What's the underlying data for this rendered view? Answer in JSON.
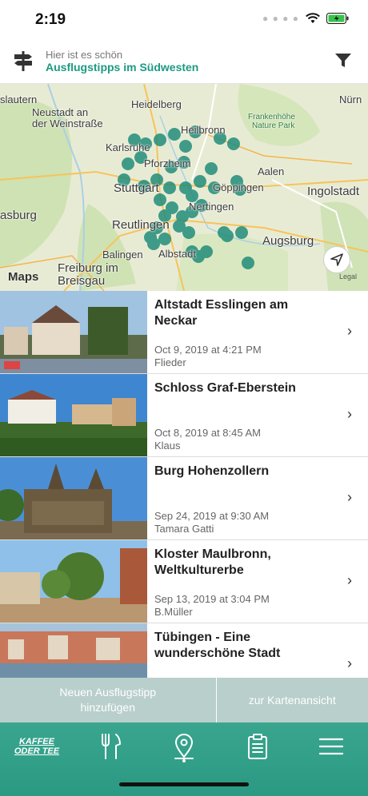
{
  "status_bar": {
    "time": "2:19"
  },
  "header": {
    "subtitle": "Hier ist es schön",
    "title": "Ausflugstipps im Südwesten",
    "icons": [
      "signpost-icon",
      "filter-icon"
    ]
  },
  "map": {
    "labels": [
      "Nürn",
      "Heidelberg",
      "Heilbronn",
      "Frankenhöhe",
      "Nature Park",
      "Karlsruhe",
      "Pforzheim",
      "Aalen",
      "Stuttgart",
      "Göppingen",
      "Ingolstadt",
      "asburg",
      "Reutlingen",
      "Nertingen",
      "Augsburg",
      "Balingen",
      "Albstadt",
      "Freiburg im",
      "Breisgau",
      "Legal",
      "slautern",
      "Neustadt an",
      "der Weinstraße",
      "Maps"
    ],
    "accent": "#1a8a78"
  },
  "list": {
    "items": [
      {
        "title": "Altstadt Esslingen am Neckar",
        "date": "Oct 9, 2019 at 4:21 PM",
        "author": "Flieder"
      },
      {
        "title": "Schloss Graf-Eberstein",
        "date": "Oct 8, 2019 at 8:45 AM",
        "author": "Klaus"
      },
      {
        "title": "Burg Hohenzollern",
        "date": "Sep 24, 2019 at 9:30 AM",
        "author": "Tamara Gatti"
      },
      {
        "title": "Kloster Maulbronn, Weltkulturerbe",
        "date": "Sep 13, 2019 at 3:04 PM",
        "author": "B.Müller"
      },
      {
        "title": "Tübingen - Eine wunderschöne Stadt",
        "date": "",
        "author": ""
      }
    ],
    "chevron": "›"
  },
  "actions": {
    "add_tip": "Neuen Ausflugstipp hinzufügen",
    "map_view": "zur Kartenansicht"
  },
  "tabbar": {
    "logo_line1": "KAFFEE",
    "logo_line2": "ODER TEE",
    "icons": [
      "fork-knife-icon",
      "map-pin-icon",
      "clipboard-icon",
      "menu-icon"
    ]
  }
}
